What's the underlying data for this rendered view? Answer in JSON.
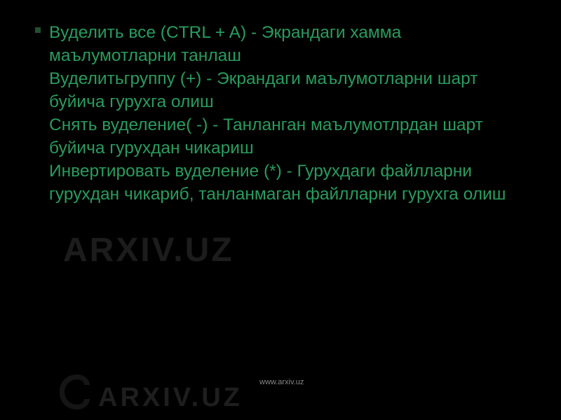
{
  "slide": {
    "bullet_text": "Вуделить все (CTRL + A) - Экрандаги хамма маълумотларни танлаш\nВуделитьгруппу (+) - Экрандаги маълумотларни шарт буйича гурухга олиш\nСнять вуделение( -) - Танланган маълумотлрдан шарт буйича гурухдан чикариш\nИнвертировать вуделение (*) - Гурухдаги файлларни гурухдан чикариб, танланмаган файлларни гурухга олиш"
  },
  "watermark": {
    "text_upper": "ARXIV.UZ",
    "text_lower": "ARXIV.UZ"
  },
  "footer": {
    "url": "www.arxiv.uz"
  }
}
